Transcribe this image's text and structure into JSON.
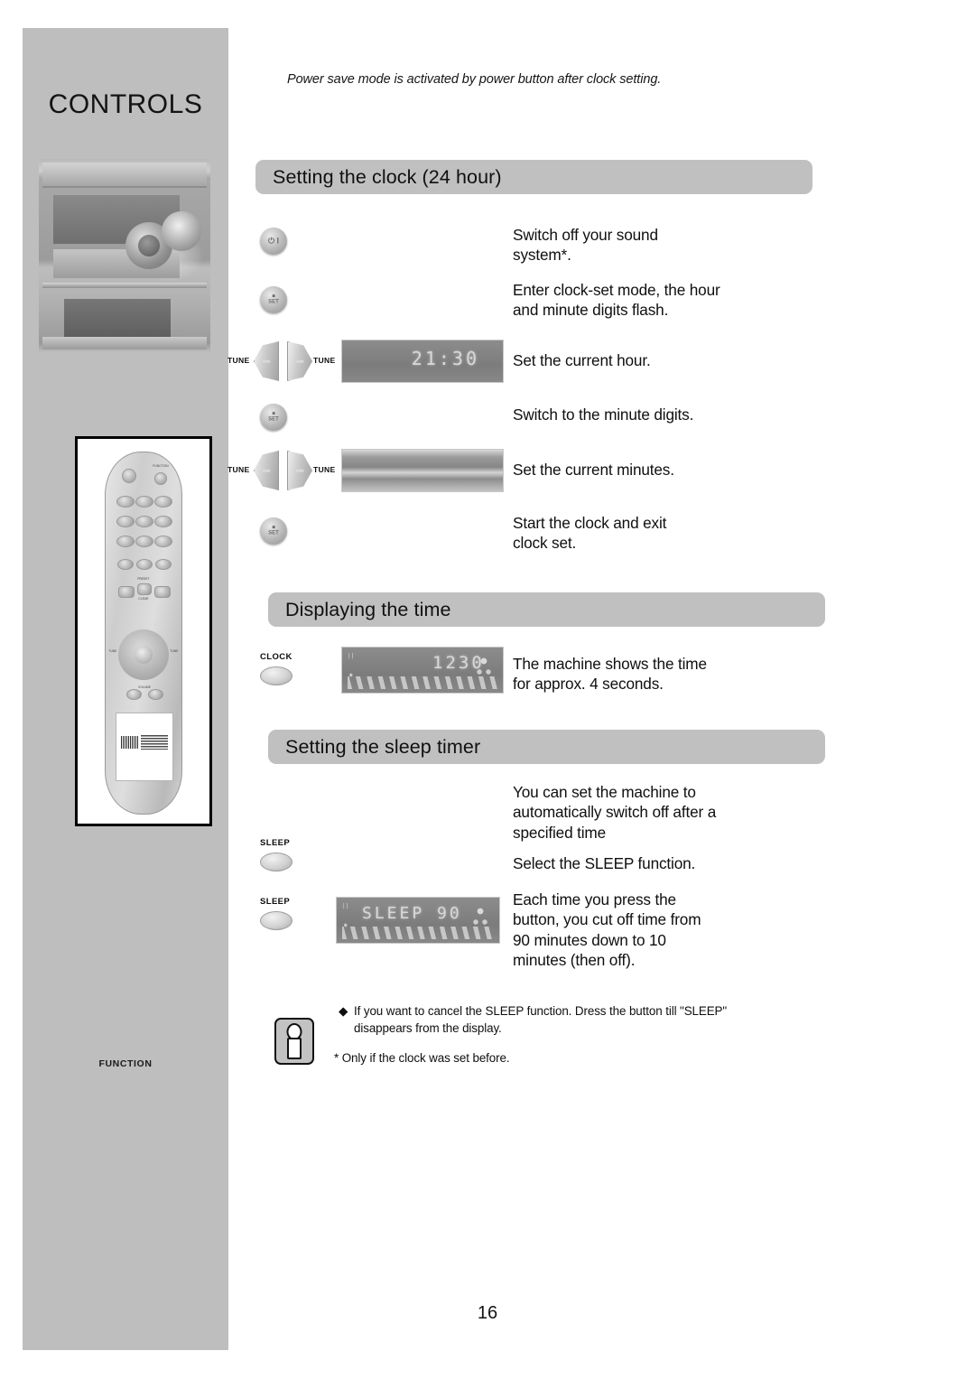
{
  "sidebar": {
    "title": "CONTROLS",
    "function_label": "FUNCTION",
    "hifi_photo_name": "hifi-system-photo",
    "remote_photo_name": "remote-control-photo"
  },
  "header": {
    "note": "Power save mode is activated by power button after clock setting."
  },
  "sections": [
    {
      "id": "clock",
      "title": "Setting the clock (24 hour)",
      "steps": [
        {
          "control": "power-button",
          "control_glyph": "⏻ I",
          "text": "Switch off your sound\nsystem*."
        },
        {
          "control": "clock-set-button",
          "control_glyph": "■\nSET",
          "text": "Enter clock-set mode, the hour\nand minute digits flash."
        },
        {
          "control": "tune-buttons",
          "left_label": "TUNE",
          "right_label": "TUNE",
          "display": "21:30",
          "text": "Set the current hour."
        },
        {
          "control": "clock-set-button",
          "control_glyph": "■\nSET",
          "text": "Switch to the minute digits."
        },
        {
          "control": "tune-buttons",
          "left_label": "TUNE",
          "right_label": "TUNE",
          "display": "",
          "text": "Set the current minutes."
        },
        {
          "control": "clock-set-button",
          "control_glyph": "■\nSET",
          "text": "Start the clock and exit\nclock set."
        }
      ]
    },
    {
      "id": "display-time",
      "title": "Displaying the time",
      "steps": [
        {
          "control": "clock-button",
          "button_label": "CLOCK",
          "display": "1230",
          "text": "The machine shows the time\nfor approx. 4 seconds."
        }
      ]
    },
    {
      "id": "sleep-timer",
      "title": "Setting the sleep timer",
      "steps": [
        {
          "control": "none",
          "text": "You can set the machine to\nautomatically switch off after a\nspecified time"
        },
        {
          "control": "sleep-button",
          "button_label": "SLEEP",
          "text": "Select the SLEEP function."
        },
        {
          "control": "sleep-button",
          "button_label": "SLEEP",
          "display": "SLEEP 90",
          "text": "Each time you press the\nbutton, you cut off time from\n90 minutes down to 10\nminutes (then off)."
        }
      ]
    }
  ],
  "notes": {
    "bullet": "◆",
    "bullet_text": "If you want to cancel the SLEEP function. Dress the button till \"SLEEP\"",
    "bullet_text_line2": "disappears from the display.",
    "footnote": "* Only if the clock was set before."
  },
  "footer": {
    "page_number": "16"
  },
  "colors": {
    "sidebar_bg": "#bebebe",
    "section_bar_bg": "#c0c0c0",
    "text": "#0f0f0f"
  }
}
